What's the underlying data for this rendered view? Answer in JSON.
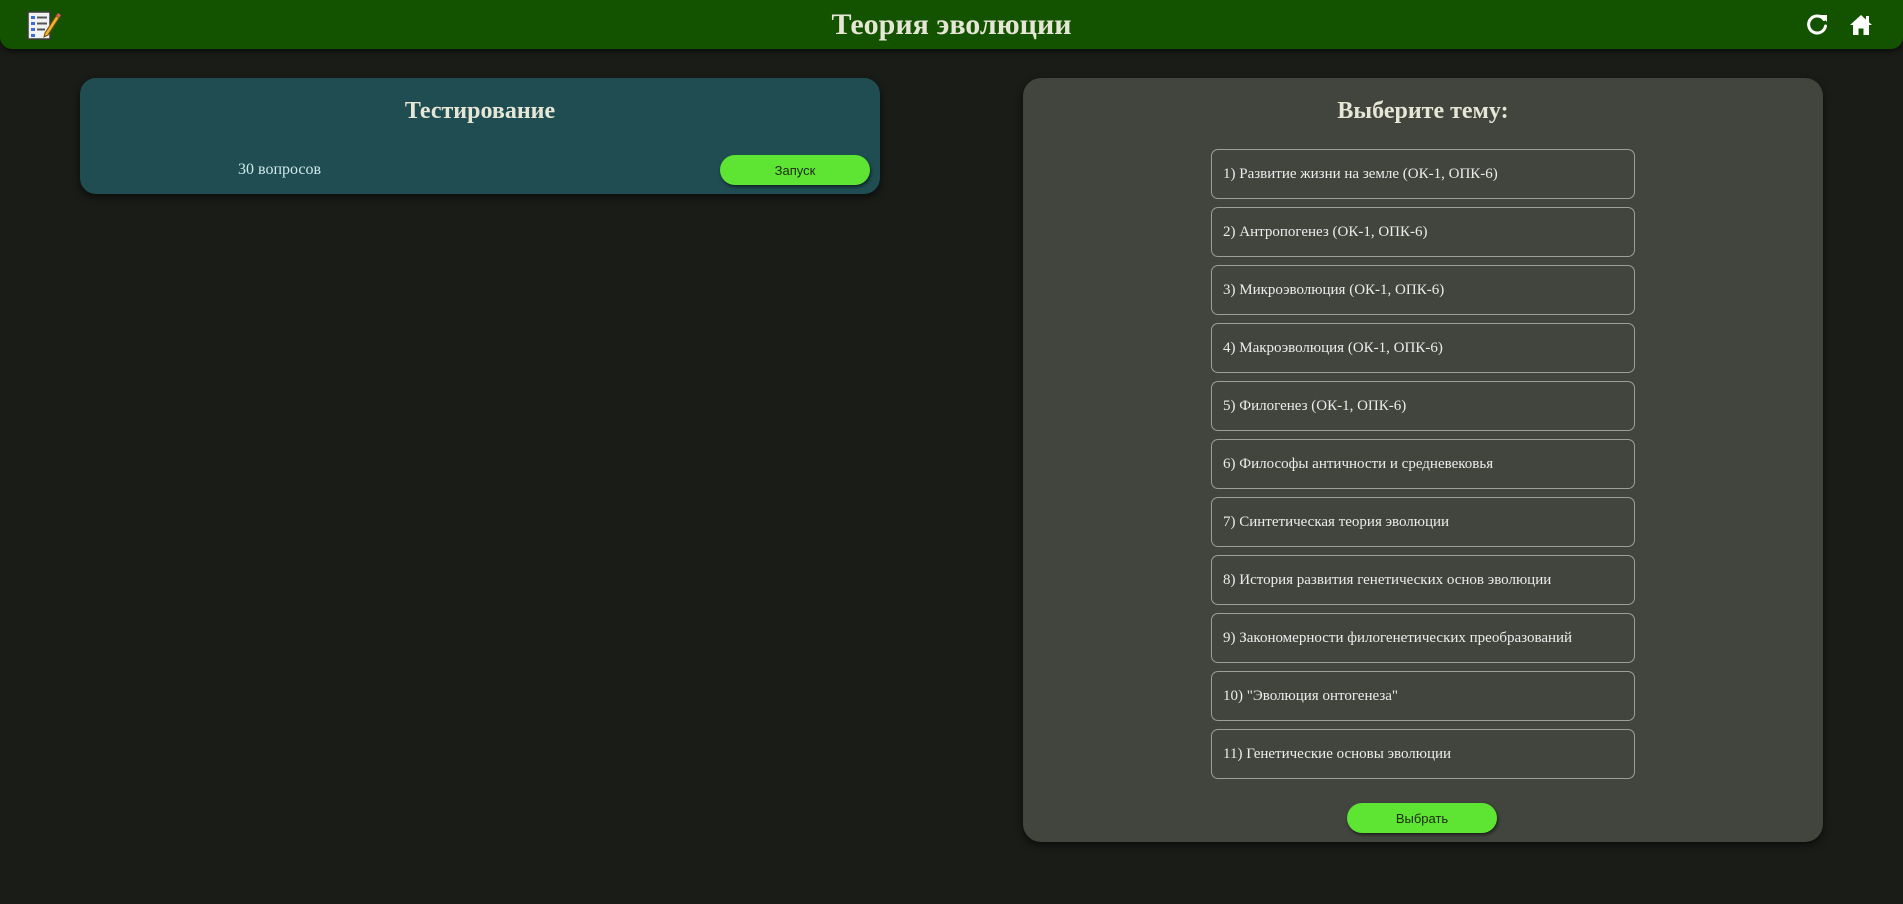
{
  "header": {
    "title": "Теория эволюции",
    "app_icon": "checklist-pencil-icon",
    "reload_icon": "reload-icon",
    "home_icon": "home-icon"
  },
  "test_card": {
    "title": "Тестирование",
    "count": "30 вопросов",
    "start_label": "Запуск"
  },
  "topic_card": {
    "title": "Выберите тему:",
    "topics": [
      "1) Развитие жизни на земле (ОК-1, ОПК-6)",
      "2) Антропогенез (ОК-1, ОПК-6)",
      "3) Микроэволюция (ОК-1, ОПК-6)",
      "4) Макроэволюция (ОК-1, ОПК-6)",
      "5) Филогенез (ОК-1, ОПК-6)",
      "6) Философы античности и средневековья",
      "7) Синтетическая теория эволюции",
      "8) История развития генетических основ эволюции",
      "9) Закономерности филогенетических преобразований",
      "10) \"Эволюция онтогенеза\"",
      "11) Генетические основы эволюции"
    ],
    "select_label": "Выбрать"
  },
  "colors": {
    "header_bg": "#135300",
    "page_bg": "#1a1c18",
    "test_card_bg": "#1f4d52",
    "topic_card_bg": "#41453e",
    "button_green": "#5ee432"
  }
}
